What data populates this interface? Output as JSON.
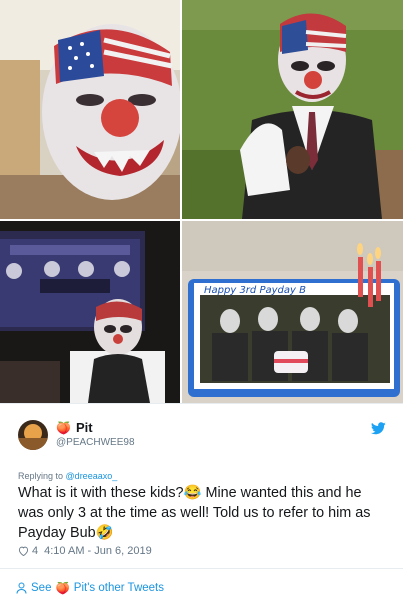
{
  "tweet": {
    "display_name": "Pit",
    "name_emoji": "🍑",
    "handle": "@PEACHWEE98",
    "reply_prefix": "Replying to",
    "reply_to": "@dreeaaxo_",
    "text": "What is it with these kids?😂 Mine wanted this and he was only 3 at the time as well! Told us to refer to him as Payday Bub🤣",
    "like_count": "4",
    "timestamp": "4:10 AM - Jun 6, 2019",
    "see_prefix": "See",
    "see_suffix": "Pit's other Tweets",
    "see_emoji": "🍑"
  },
  "photos": {
    "cake_text": "Happy 3rd Payday B"
  },
  "colors": {
    "twitter_blue": "#1b95e0",
    "text_primary": "#14171a",
    "text_secondary": "#657786"
  },
  "icons": [
    "twitter-bird-icon",
    "heart-outline-icon",
    "person-icon",
    "peach-icon"
  ]
}
